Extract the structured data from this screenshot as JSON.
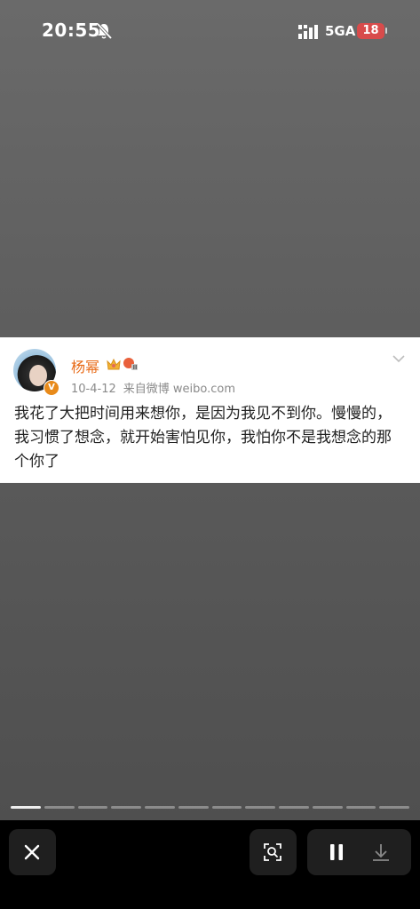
{
  "status_bar": {
    "time": "20:55",
    "network": "5GA",
    "battery": "18",
    "icons": [
      "bell-slash-icon",
      "signal-bars-icon",
      "battery-icon"
    ]
  },
  "post": {
    "author": "杨幂",
    "date": "10-4-12",
    "source": "来自微博 weibo.com",
    "text": "我花了大把时间用来想你，是因为我见不到你。慢慢的，我习惯了想念，就开始害怕见你，我怕你不是我想念的那个你了",
    "verified_badge": "V",
    "author_color": "#e86b18",
    "icons": [
      "crown-icon",
      "fan-badge-icon",
      "chevron-down-icon"
    ]
  },
  "story": {
    "segments": 12,
    "current_segment": 1
  },
  "controls": {
    "icons": [
      "close-icon",
      "scan-icon",
      "pause-icon",
      "download-icon"
    ]
  }
}
